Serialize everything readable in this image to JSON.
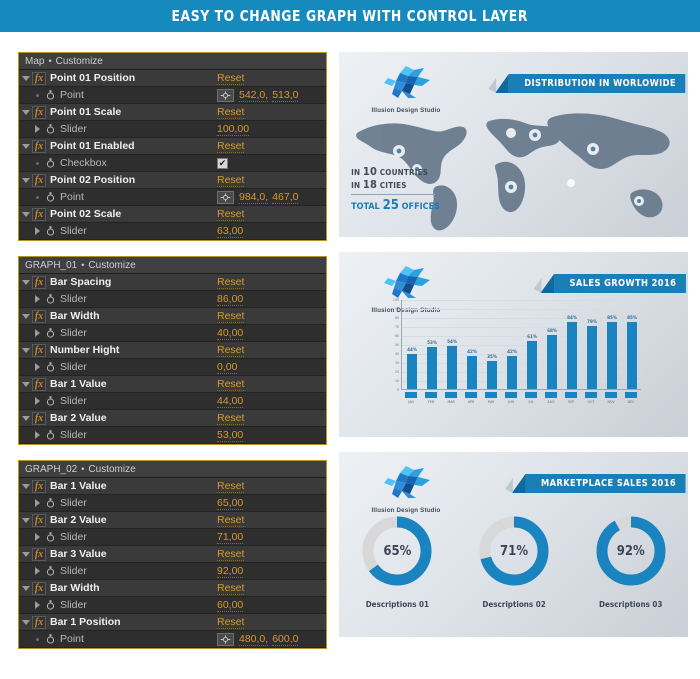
{
  "header": {
    "title": "EASY TO CHANGE GRAPH WITH CONTROL LAYER"
  },
  "colors": {
    "brand_blue": "#1689bd",
    "chart_blue": "#1a84c0",
    "panel_border_gold": "#b79520",
    "value_amber": "#d79b2b",
    "panel_bg": "#2b2b2b"
  },
  "panels": [
    {
      "title": "Map",
      "separator": "•",
      "subtitle": "Customize",
      "rows": [
        {
          "type": "prop",
          "twirl": "down",
          "fx": "fx",
          "label": "Point 01 Position",
          "control": "reset",
          "reset_label": "Reset"
        },
        {
          "type": "sub",
          "twirl": "none",
          "stopwatch": true,
          "label": "Point",
          "control": "point",
          "picker_icon": "crosshair-picker-icon",
          "values": [
            "542,0",
            "513,0"
          ]
        },
        {
          "type": "prop",
          "twirl": "down",
          "fx": "fx",
          "label": "Point 01 Scale",
          "control": "reset",
          "reset_label": "Reset"
        },
        {
          "type": "sub",
          "twirl": "right",
          "stopwatch": true,
          "label": "Slider",
          "control": "value",
          "value": "100,00"
        },
        {
          "type": "prop",
          "twirl": "down",
          "fx": "fx",
          "label": "Point 01 Enabled",
          "control": "reset",
          "reset_label": "Reset"
        },
        {
          "type": "sub",
          "twirl": "none",
          "stopwatch": true,
          "label": "Checkbox",
          "control": "checkbox",
          "checked": true
        },
        {
          "type": "prop",
          "twirl": "down",
          "fx": "fx",
          "label": "Point 02 Position",
          "control": "reset",
          "reset_label": "Reset"
        },
        {
          "type": "sub",
          "twirl": "none",
          "stopwatch": true,
          "label": "Point",
          "control": "point",
          "picker_icon": "crosshair-picker-icon",
          "values": [
            "984,0",
            "467,0"
          ]
        },
        {
          "type": "prop",
          "twirl": "down",
          "fx": "fx",
          "label": "Point 02 Scale",
          "control": "reset",
          "reset_label": "Reset"
        },
        {
          "type": "sub",
          "twirl": "right",
          "stopwatch": true,
          "label": "Slider",
          "control": "value",
          "value": "63,00"
        }
      ]
    },
    {
      "title": "GRAPH_01",
      "separator": "•",
      "subtitle": "Customize",
      "rows": [
        {
          "type": "prop",
          "twirl": "down",
          "fx": "fx",
          "label": "Bar Spacing",
          "control": "reset",
          "reset_label": "Reset"
        },
        {
          "type": "sub",
          "twirl": "right",
          "stopwatch": true,
          "label": "Slider",
          "control": "value",
          "value": "86,00"
        },
        {
          "type": "prop",
          "twirl": "down",
          "fx": "fx",
          "label": "Bar Width",
          "control": "reset",
          "reset_label": "Reset"
        },
        {
          "type": "sub",
          "twirl": "right",
          "stopwatch": true,
          "label": "Slider",
          "control": "value",
          "value": "40,00"
        },
        {
          "type": "prop",
          "twirl": "down",
          "fx": "fx",
          "label": "Number Hight",
          "control": "reset",
          "reset_label": "Reset"
        },
        {
          "type": "sub",
          "twirl": "right",
          "stopwatch": true,
          "label": "Slider",
          "control": "value",
          "value": "0,00"
        },
        {
          "type": "prop",
          "twirl": "down",
          "fx": "fx",
          "label": "Bar 1 Value",
          "control": "reset",
          "reset_label": "Reset"
        },
        {
          "type": "sub",
          "twirl": "right",
          "stopwatch": true,
          "label": "Slider",
          "control": "value",
          "value": "44,00"
        },
        {
          "type": "prop",
          "twirl": "down",
          "fx": "fx",
          "label": "Bar 2 Value",
          "control": "reset",
          "reset_label": "Reset"
        },
        {
          "type": "sub",
          "twirl": "right",
          "stopwatch": true,
          "label": "Slider",
          "control": "value",
          "value": "53,00"
        }
      ]
    },
    {
      "title": "GRAPH_02",
      "separator": "•",
      "subtitle": "Customize",
      "rows": [
        {
          "type": "prop",
          "twirl": "down",
          "fx": "fx",
          "label": "Bar 1 Value",
          "control": "reset",
          "reset_label": "Reset"
        },
        {
          "type": "sub",
          "twirl": "right",
          "stopwatch": true,
          "label": "Slider",
          "control": "value",
          "value": "65,00"
        },
        {
          "type": "prop",
          "twirl": "down",
          "fx": "fx",
          "label": "Bar 2 Value",
          "control": "reset",
          "reset_label": "Reset"
        },
        {
          "type": "sub",
          "twirl": "right",
          "stopwatch": true,
          "label": "Slider",
          "control": "value",
          "value": "71,00"
        },
        {
          "type": "prop",
          "twirl": "down",
          "fx": "fx",
          "label": "Bar 3 Value",
          "control": "reset",
          "reset_label": "Reset"
        },
        {
          "type": "sub",
          "twirl": "right",
          "stopwatch": true,
          "label": "Slider",
          "control": "value",
          "value": "92,00"
        },
        {
          "type": "prop",
          "twirl": "down",
          "fx": "fx",
          "label": "Bar Width",
          "control": "reset",
          "reset_label": "Reset"
        },
        {
          "type": "sub",
          "twirl": "right",
          "stopwatch": true,
          "label": "Slider",
          "control": "value",
          "value": "60,00"
        },
        {
          "type": "prop",
          "twirl": "down",
          "fx": "fx",
          "label": "Bar 1 Position",
          "control": "reset",
          "reset_label": "Reset"
        },
        {
          "type": "sub",
          "twirl": "none",
          "stopwatch": true,
          "label": "Point",
          "control": "point",
          "picker_icon": "crosshair-picker-icon",
          "values": [
            "480,0",
            "600,0"
          ]
        }
      ]
    }
  ],
  "previews": {
    "map": {
      "logo_name": "Illusion Design Studio",
      "ribbon": "DISTRIBUTION IN WORLOWIDE",
      "stats": {
        "countries_prefix": "IN",
        "countries_value": "10",
        "countries_label": "COUNTRIES",
        "cities_prefix": "IN",
        "cities_value": "18",
        "cities_label": "CITIES",
        "total_prefix": "TOTAL",
        "total_value": "25",
        "total_label": "OFFICES"
      }
    },
    "bars": {
      "logo_name": "Illusion Design Studio",
      "ribbon": "SALES GROWTH 2016"
    },
    "donuts": {
      "logo_name": "Illusion Design Studio",
      "ribbon": "MARKETPLACE SALES 2016"
    }
  },
  "chart_data": [
    {
      "type": "bar",
      "title": "SALES GROWTH 2016",
      "xlabel": "",
      "ylabel": "",
      "ylim": [
        0,
        100
      ],
      "yticks": [
        0,
        10,
        20,
        30,
        40,
        50,
        60,
        70,
        80,
        90,
        100
      ],
      "grid": true,
      "legend": "none",
      "categories": [
        "JAN",
        "FEB",
        "MAR",
        "APR",
        "MAY",
        "JUN",
        "JUL",
        "AUG",
        "SEP",
        "OCT",
        "NOV",
        "DEC"
      ],
      "values": [
        44,
        53,
        54,
        42,
        35,
        42,
        61,
        68,
        84,
        79,
        85,
        85
      ],
      "data_labels": [
        "44%",
        "53%",
        "54%",
        "42%",
        "35%",
        "42%",
        "61%",
        "68%",
        "84%",
        "79%",
        "85%",
        "85%"
      ]
    },
    {
      "type": "pie",
      "title": "MARKETPLACE SALES 2016",
      "subtype": "donut",
      "slices": [
        {
          "label": "Descriptions 01",
          "value": 65,
          "display": "65%"
        },
        {
          "label": "Descriptions 02",
          "value": 71,
          "display": "71%"
        },
        {
          "label": "Descriptions 03",
          "value": 92,
          "display": "92%"
        }
      ],
      "track_color": "#d8d8d8",
      "fill_color": "#1a84c0"
    }
  ]
}
